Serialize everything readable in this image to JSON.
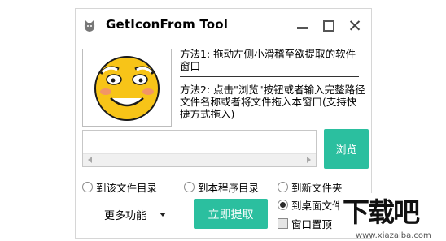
{
  "window": {
    "title": "GetIconFrom Tool",
    "icons": {
      "app": "cat-icon",
      "minimize": "minimize-icon",
      "maximize": "maximize-icon",
      "close": "close-icon"
    }
  },
  "instructions": {
    "method1": "方法1: 拖动左侧小滑稽至欲提取的软件窗口",
    "method2": "方法2: 点击\"浏览\"按钮或者输入完整路径文件名称或者将文件拖入本窗口(支持快捷方式拖入)"
  },
  "path_input": {
    "value": "",
    "placeholder": ""
  },
  "browse_button": {
    "label": "浏览"
  },
  "save_options": [
    {
      "label": "到该文件目录",
      "selected": false
    },
    {
      "label": "到本程序目录",
      "selected": false
    },
    {
      "label": "到新文件夹",
      "selected": false
    },
    {
      "label": "到桌面文件夹",
      "selected": true
    }
  ],
  "more_menu": {
    "label": "更多功能"
  },
  "extract_button": {
    "label": "立即提取"
  },
  "topmost_checkbox": {
    "label": "窗口置顶",
    "checked": false
  },
  "watermark": {
    "logo": "下载吧",
    "url": "www.xiazaiba.com"
  },
  "colors": {
    "accent": "#2bbf9f",
    "smiley_face": "#f7c418",
    "smiley_outline": "#1a1a1a"
  }
}
